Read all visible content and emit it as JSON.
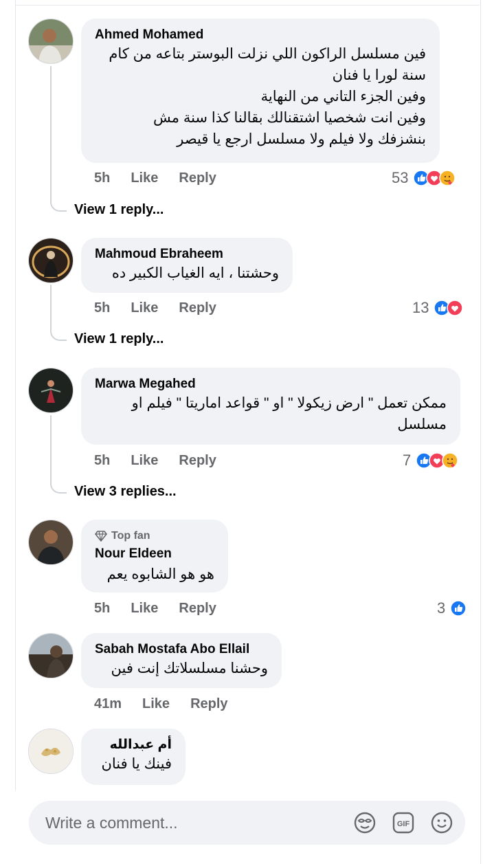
{
  "comments": [
    {
      "author": "Ahmed Mohamed",
      "lines": [
        "فين مسلسل الراكون اللي نزلت البوستر بتاعه من كام",
        "سنة لورا يا فنان",
        "وفين الجزء التاني من النهاية",
        "وفين انت شخصيا اشتقنالك بقالنا كذا سنة مش",
        "بنشزفك ولا فيلم ولا مسلسل ارجع يا  قيصر"
      ],
      "time": "5h",
      "like": "Like",
      "reply": "Reply",
      "reaction_count": "53",
      "reactions": [
        "like-icon",
        "love-icon",
        "care-icon"
      ],
      "view_replies": "View 1 reply..."
    },
    {
      "author": "Mahmoud Ebraheem",
      "lines": [
        "وحشتنا ، ايه الغياب الكبير ده"
      ],
      "time": "5h",
      "like": "Like",
      "reply": "Reply",
      "reaction_count": "13",
      "reactions": [
        "like-icon",
        "love-icon"
      ],
      "view_replies": "View 1 reply..."
    },
    {
      "author": "Marwa Megahed",
      "lines": [
        "ممكن تعمل \" ارض زيكولا \" او \" قواعد اماريتا \" فيلم او",
        "مسلسل"
      ],
      "time": "5h",
      "like": "Like",
      "reply": "Reply",
      "reaction_count": "7",
      "reactions": [
        "like-icon",
        "love-icon",
        "care-icon"
      ],
      "view_replies": "View 3 replies..."
    },
    {
      "badge": "Top fan",
      "author": "Nour Eldeen",
      "lines": [
        "هو هو الشابوه يعم"
      ],
      "time": "5h",
      "like": "Like",
      "reply": "Reply",
      "reaction_count": "3",
      "reactions": [
        "like-icon"
      ]
    },
    {
      "author": "Sabah Mostafa Abo Ellail",
      "lines": [
        "وحشنا مسلسلاتك إنت فين"
      ],
      "time": "41m",
      "like": "Like",
      "reply": "Reply"
    },
    {
      "author": "أم عبدالله",
      "lines": [
        "فينك يا فنان"
      ]
    }
  ],
  "composer": {
    "placeholder": "Write a comment...",
    "icons": [
      "sticker-icon",
      "gif-icon",
      "emoji-icon"
    ],
    "gif_label": "GIF"
  },
  "colors": {
    "like": "#1877f2",
    "love": "#f33e58",
    "care": "#f7b125",
    "bubble": "#f0f2f5",
    "secondary_text": "#65676b"
  }
}
